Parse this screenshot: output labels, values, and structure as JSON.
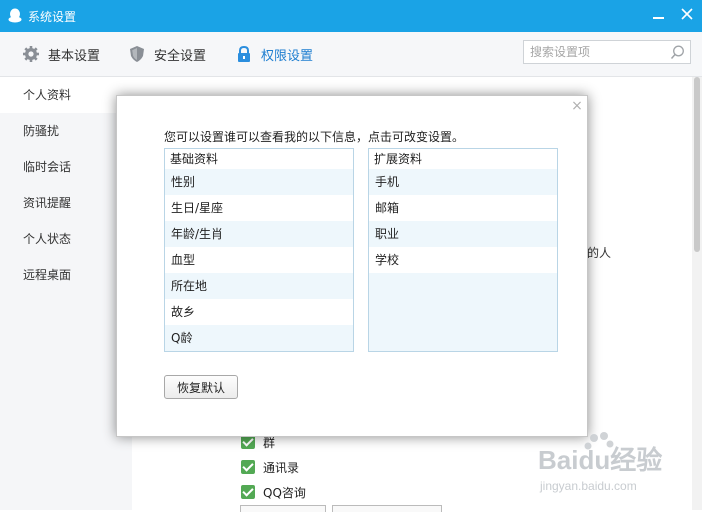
{
  "window": {
    "title": "系统设置"
  },
  "toolbar": {
    "tabs": [
      {
        "label": "基本设置",
        "icon": "gear-icon"
      },
      {
        "label": "安全设置",
        "icon": "shield-icon"
      },
      {
        "label": "权限设置",
        "icon": "lock-icon",
        "active": true
      }
    ],
    "search_placeholder": "搜索设置项"
  },
  "sidebar": {
    "items": [
      {
        "label": "个人资料",
        "active": true
      },
      {
        "label": "防骚扰"
      },
      {
        "label": "临时会话"
      },
      {
        "label": "资讯提醒"
      },
      {
        "label": "个人状态"
      },
      {
        "label": "远程桌面"
      }
    ]
  },
  "background": {
    "partial_text": "的人",
    "checks": [
      "群",
      "通讯录",
      "QQ咨询"
    ]
  },
  "dialog": {
    "description": "您可以设置谁可以查看我的以下信息，点击可改变设置。",
    "basic_list": {
      "header": "基础资料",
      "items": [
        "性别",
        "生日/星座",
        "年龄/生肖",
        "血型",
        "所在地",
        "故乡",
        "Q龄"
      ]
    },
    "extended_list": {
      "header": "扩展资料",
      "items": [
        "手机",
        "邮箱",
        "职业",
        "学校"
      ]
    },
    "restore_label": "恢复默认"
  },
  "watermark": {
    "brand": "Baidu经验",
    "url": "jingyan.baidu.com"
  },
  "colors": {
    "titlebar": "#1aa3e6",
    "active_tab": "#1e7ed0",
    "list_bg": "#eef7fc",
    "check": "#53a954"
  }
}
